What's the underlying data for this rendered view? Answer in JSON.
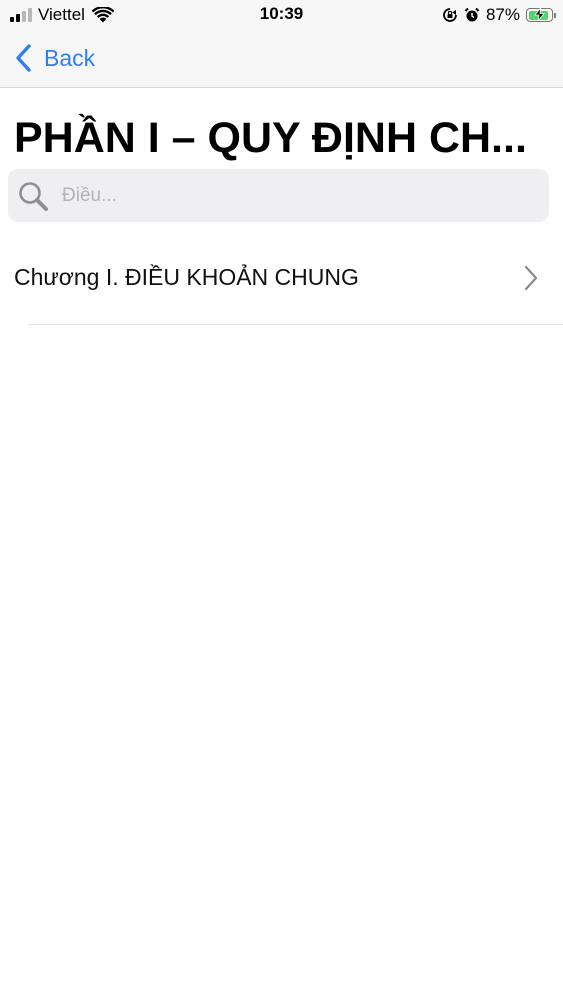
{
  "status_bar": {
    "carrier": "Viettel",
    "time": "10:39",
    "battery_percent": "87%",
    "battery_level": 0.87,
    "icons": [
      "signal-icon",
      "wifi-icon",
      "orientation-lock-icon",
      "alarm-icon",
      "battery-icon",
      "charging-bolt-icon"
    ]
  },
  "nav": {
    "back_label": "Back"
  },
  "page": {
    "title": "PHẦN I – QUY ĐỊNH CH..."
  },
  "search": {
    "placeholder": "Điều...",
    "value": ""
  },
  "list": {
    "items": [
      {
        "label": "Chương I. ĐIỀU KHOẢN CHUNG"
      }
    ]
  },
  "colors": {
    "accent": "#2f7cf6",
    "chrome_background": "#f7f7f7",
    "search_background": "#efeff1",
    "battery_fill": "#4cd964"
  }
}
